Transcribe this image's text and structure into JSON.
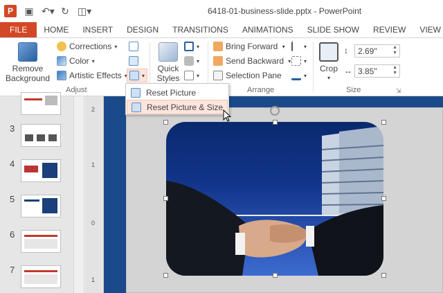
{
  "app": {
    "logo_letter": "P",
    "window_title": "6418-01-business-slide.pptx - PowerPoint"
  },
  "qat": {
    "save_icon": "save-icon",
    "undo_icon": "undo-icon",
    "redo_icon": "redo-icon",
    "present_icon": "present-from-beginning-icon"
  },
  "tabs": [
    "FILE",
    "HOME",
    "INSERT",
    "DESIGN",
    "TRANSITIONS",
    "ANIMATIONS",
    "SLIDE SHOW",
    "REVIEW",
    "VIEW"
  ],
  "ribbon": {
    "adjust": {
      "label": "Adjust",
      "remove_background_line1": "Remove",
      "remove_background_line2": "Background",
      "corrections": "Corrections",
      "color": "Color",
      "artistic_effects": "Artistic Effects"
    },
    "picture_styles": {
      "quick_styles_line1": "Quick",
      "quick_styles_line2": "Styles"
    },
    "arrange": {
      "label": "Arrange",
      "bring_forward": "Bring Forward",
      "send_backward": "Send Backward",
      "selection_pane": "Selection Pane"
    },
    "size": {
      "label": "Size",
      "crop": "Crop",
      "height": "2.69\"",
      "width": "3.85\""
    }
  },
  "reset_menu": {
    "items": [
      "Reset Picture",
      "Reset Picture & Size"
    ],
    "highlighted_index": 1
  },
  "slides": {
    "numbers": [
      "3",
      "4",
      "5",
      "6",
      "7"
    ]
  },
  "ruler": {
    "marks": [
      "2",
      "1",
      "0",
      "1"
    ]
  },
  "colors": {
    "accent": "#d24726",
    "workspace": "#1a4a8a"
  }
}
